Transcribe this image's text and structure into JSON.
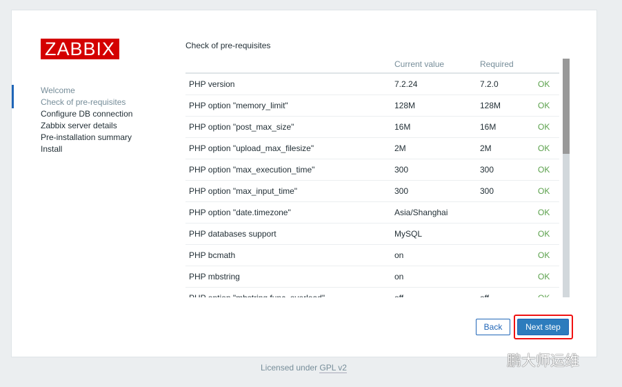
{
  "logo": "ZABBIX",
  "steps": [
    {
      "label": "Welcome",
      "state": "done"
    },
    {
      "label": "Check of pre-requisites",
      "state": "current"
    },
    {
      "label": "Configure DB connection"
    },
    {
      "label": "Zabbix server details"
    },
    {
      "label": "Pre-installation summary"
    },
    {
      "label": "Install"
    }
  ],
  "title": "Check of pre-requisites",
  "columns": [
    "",
    "Current value",
    "Required",
    ""
  ],
  "rows": [
    [
      "PHP version",
      "7.2.24",
      "7.2.0",
      "OK"
    ],
    [
      "PHP option \"memory_limit\"",
      "128M",
      "128M",
      "OK"
    ],
    [
      "PHP option \"post_max_size\"",
      "16M",
      "16M",
      "OK"
    ],
    [
      "PHP option \"upload_max_filesize\"",
      "2M",
      "2M",
      "OK"
    ],
    [
      "PHP option \"max_execution_time\"",
      "300",
      "300",
      "OK"
    ],
    [
      "PHP option \"max_input_time\"",
      "300",
      "300",
      "OK"
    ],
    [
      "PHP option \"date.timezone\"",
      "Asia/Shanghai",
      "",
      "OK"
    ],
    [
      "PHP databases support",
      "MySQL",
      "",
      "OK"
    ],
    [
      "PHP bcmath",
      "on",
      "",
      "OK"
    ],
    [
      "PHP mbstring",
      "on",
      "",
      "OK"
    ],
    [
      "PHP option \"mbstring.func_overload\"",
      "off",
      "off",
      "OK"
    ]
  ],
  "buttons": {
    "back": "Back",
    "next": "Next step"
  },
  "footer": {
    "text": "Licensed under ",
    "link": "GPL v2"
  },
  "watermark": "鹏大师运维",
  "colors": {
    "ok": "#59a04a",
    "accent": "#1f65b7",
    "logo": "#d40000"
  }
}
